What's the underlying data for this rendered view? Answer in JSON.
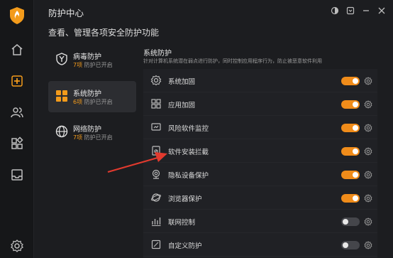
{
  "app": {
    "title": "防护中心"
  },
  "page": {
    "title": "查看、管理各项安全防护功能"
  },
  "categories": [
    {
      "name": "病毒防护",
      "count": "7项",
      "status": "防护已开启",
      "icon": "shield-y-icon",
      "active": false
    },
    {
      "name": "系统防护",
      "count": "6项",
      "status": "防护已开启",
      "icon": "grid-icon",
      "active": true
    },
    {
      "name": "网络防护",
      "count": "7项",
      "status": "防护已开启",
      "icon": "globe-icon",
      "active": false
    }
  ],
  "panel": {
    "title": "系统防护",
    "description": "针对计算机系统潜在弱点进行防护，同时控制应用程序行为，防止被恶意软件利用"
  },
  "items": [
    {
      "label": "系统加固",
      "enabled": true,
      "icon": "gear-shield-icon"
    },
    {
      "label": "应用加固",
      "enabled": true,
      "icon": "apps-icon"
    },
    {
      "label": "风险软件监控",
      "enabled": true,
      "icon": "monitor-icon"
    },
    {
      "label": "软件安装拦截",
      "enabled": true,
      "icon": "install-block-icon"
    },
    {
      "label": "隐私设备保护",
      "enabled": true,
      "icon": "webcam-icon"
    },
    {
      "label": "浏览器保护",
      "enabled": true,
      "icon": "browser-icon"
    },
    {
      "label": "联网控制",
      "enabled": false,
      "icon": "network-icon"
    },
    {
      "label": "自定义防护",
      "enabled": false,
      "icon": "custom-icon"
    }
  ],
  "colors": {
    "accent": "#f08c1a",
    "background": "#1c1d20",
    "panel": "#202125"
  }
}
